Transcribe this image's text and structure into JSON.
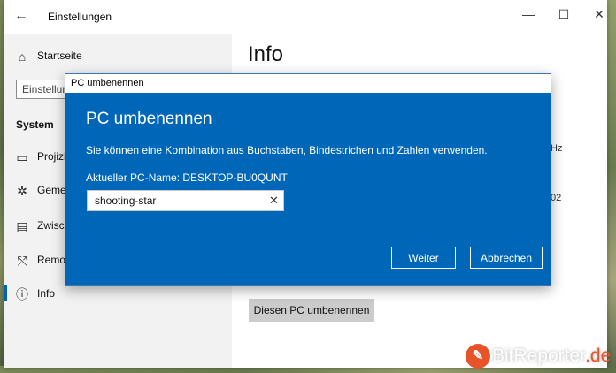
{
  "window": {
    "title": "Einstellungen",
    "controls": {
      "minimize": "—",
      "maximize": "☐",
      "close": "✕"
    }
  },
  "sidebar": {
    "home_label": "Startseite",
    "search_placeholder": "Einstellun",
    "section_heading": "System",
    "items": [
      {
        "label": "Projizi",
        "icon": "projector-icon"
      },
      {
        "label": "Gemei",
        "icon": "shared-experiences-icon"
      },
      {
        "label": "Zwisch",
        "icon": "clipboard-icon"
      },
      {
        "label": "Remot",
        "icon": "remote-desktop-icon"
      },
      {
        "label": "Info",
        "icon": "info-icon",
        "active": true
      }
    ]
  },
  "main": {
    "title": "Info",
    "partial_value_1": "Hz",
    "partial_value_2": "02",
    "rename_button": "Diesen PC umbenennen"
  },
  "dialog": {
    "window_title": "PC umbenennen",
    "heading": "PC umbenennen",
    "description": "Sie können eine Kombination aus Buchstaben, Bindestrichen und Zahlen verwenden.",
    "current_name": "Aktueller PC-Name: DESKTOP-BU0QUNT",
    "input_value": "shooting-star",
    "next_button": "Weiter",
    "cancel_button": "Abbrechen"
  },
  "watermark": {
    "brand_main": "BitReporter",
    "brand_suffix": ".de"
  },
  "colors": {
    "accent": "#0067b8",
    "sidebar_bg": "#f2f2f2",
    "logo_orange": "#e8542a"
  }
}
